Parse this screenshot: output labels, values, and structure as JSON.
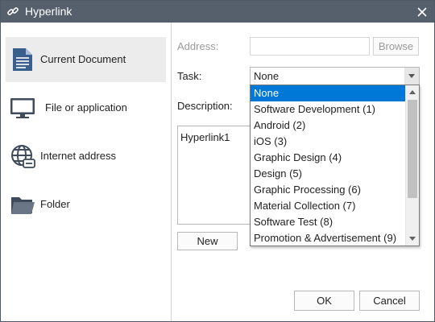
{
  "window": {
    "title": "Hyperlink",
    "title_icon": "link-icon",
    "close_icon": "close-icon"
  },
  "sidebar": {
    "items": [
      {
        "label": "Current Document",
        "icon": "document-icon",
        "selected": true
      },
      {
        "label": "File or application",
        "icon": "monitor-icon",
        "selected": false
      },
      {
        "label": "Internet address",
        "icon": "globe-icon",
        "selected": false
      },
      {
        "label": "Folder",
        "icon": "folder-icon",
        "selected": false
      }
    ]
  },
  "form": {
    "address_label": "Address:",
    "address_value": "",
    "browse_label": "Browse",
    "task_label": "Task:",
    "task_selected": "None",
    "description_label": "Description:",
    "description_value": "Hyperlink1",
    "new_label": "New"
  },
  "task_dropdown": {
    "options": [
      "None",
      "Software Development (1)",
      "Android (2)",
      "iOS (3)",
      "Graphic Design (4)",
      "Design (5)",
      "Graphic Processing (6)",
      "Material Collection (7)",
      "Software Test (8)",
      "Promotion & Advertisement (9)"
    ],
    "highlighted_index": 0
  },
  "footer": {
    "ok_label": "OK",
    "cancel_label": "Cancel"
  },
  "colors": {
    "titlebar": "#56606d",
    "selection": "#0078d7",
    "sidebar_selected": "#ececec"
  }
}
